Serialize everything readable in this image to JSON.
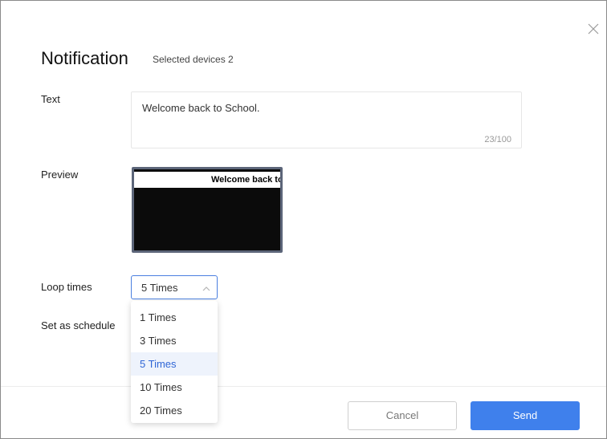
{
  "dialog": {
    "title": "Notification",
    "subtitle": "Selected devices 2",
    "close_icon": "close-icon"
  },
  "text_field": {
    "label": "Text",
    "value": "Welcome back to School.",
    "counter": "23/100"
  },
  "preview": {
    "label": "Preview",
    "text": "Welcome back to"
  },
  "loop_times": {
    "label": "Loop times",
    "selected": "5 Times",
    "arrow_icon": "chevron-up-icon",
    "options": [
      "1 Times",
      "3 Times",
      "5 Times",
      "10 Times",
      "20 Times"
    ],
    "selected_index": 2
  },
  "schedule": {
    "label": "Set as schedule"
  },
  "footer": {
    "cancel_label": "Cancel",
    "send_label": "Send"
  },
  "colors": {
    "accent": "#3f80ec",
    "selected_option_bg": "#eef3fc",
    "preview_bg": "#0b0b0b"
  }
}
